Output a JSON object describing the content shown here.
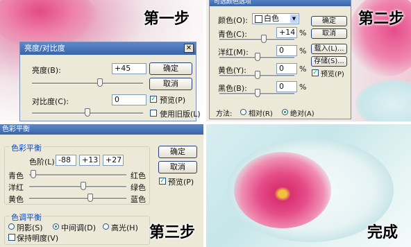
{
  "steps": {
    "step1": "第一步",
    "step2": "第二步",
    "step3": "第三步",
    "done": "完成"
  },
  "dialog1": {
    "title": "亮度/对比度",
    "brightness_label": "亮度(B):",
    "brightness_value": "+45",
    "contrast_label": "对比度(C):",
    "contrast_value": "0",
    "ok": "确定",
    "cancel": "取消",
    "preview": "预览(P)",
    "legacy": "使用旧版(L)",
    "brightness_level": 0.61,
    "contrast_level": 0.5
  },
  "dialog2": {
    "title": "可选颜色选项",
    "colors_label": "颜色(O):",
    "colors_value": "白色",
    "cyan_label": "青色(C):",
    "cyan_value": "+14",
    "magenta_label": "洋红(M):",
    "magenta_value": "0",
    "yellow_label": "黄色(Y):",
    "yellow_value": "0",
    "black_label": "黑色(B):",
    "black_value": "0",
    "percent": "%",
    "ok": "确定",
    "cancel": "取消",
    "load": "载入(L)...",
    "save": "存储(S)...",
    "preview": "预览(P)",
    "method_label": "方法:",
    "relative": "相对(R)",
    "absolute": "绝对(A)"
  },
  "dialog3": {
    "title": "色彩平衡",
    "group_balance": "色彩平衡",
    "levels_label": "色阶(L):",
    "level1": "-88",
    "level2": "+13",
    "level3": "+27",
    "cyan": "青色",
    "red": "红色",
    "magenta": "洋红",
    "green": "绿色",
    "yellow": "黄色",
    "blue": "蓝色",
    "group_tone": "色调平衡",
    "shadows": "阴影(S)",
    "midtones": "中间调(D)",
    "highlights": "高光(H)",
    "preserve": "保持明度(V)",
    "ok": "确定",
    "cancel": "取消",
    "preview": "预览(P)"
  }
}
